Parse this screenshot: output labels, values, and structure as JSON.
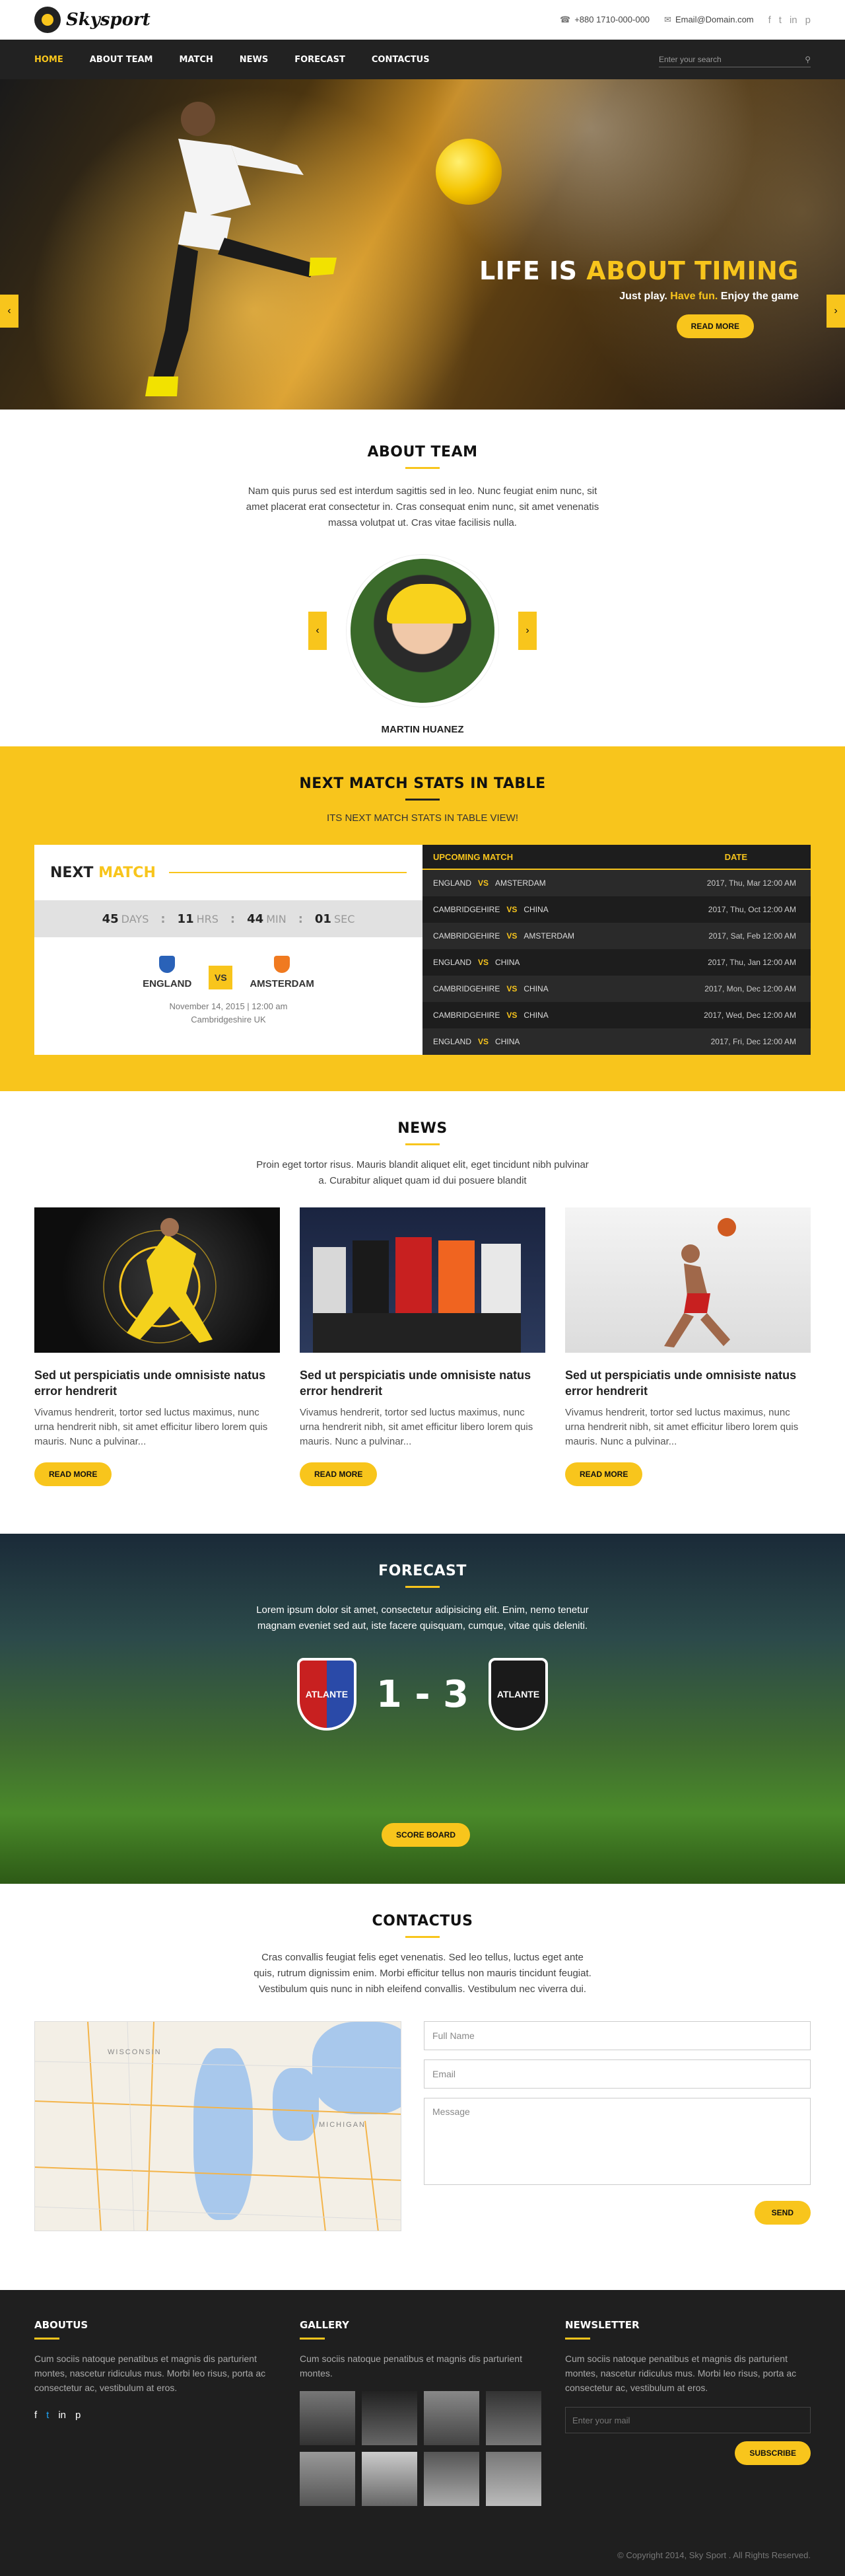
{
  "brand": {
    "logo_text": "Skysport"
  },
  "topbar": {
    "phone": "+880 1710-000-000",
    "email": "Email@Domain.com",
    "social": [
      "f",
      "t",
      "in",
      "p"
    ]
  },
  "nav": {
    "items": [
      "HOME",
      "ABOUT TEAM",
      "MATCH",
      "NEWS",
      "FORECAST",
      "CONTACTUS"
    ],
    "active": "HOME",
    "search_placeholder": "Enter your search"
  },
  "hero": {
    "title_plain": "LIFE IS",
    "title_accent": "ABOUT TIMING",
    "sub_a": "Just play.",
    "sub_b": "Have fun.",
    "sub_c": "Enjoy the game",
    "button": "READ MORE"
  },
  "about": {
    "title": "ABOUT TEAM",
    "text": "Nam quis purus sed est interdum sagittis sed in leo. Nunc feugiat enim nunc, sit amet placerat erat consectetur in. Cras consequat enim nunc, sit amet venenatis massa volutpat ut. Cras vitae facilisis nulla.",
    "coach": "MARTIN HUANEZ"
  },
  "stats": {
    "title": "NEXT MATCH STATS IN TABLE",
    "subtitle": "ITS NEXT MATCH STATS IN TABLE VIEW!",
    "next_plain": "NEXT",
    "next_accent": "MATCH",
    "countdown": {
      "days": "45",
      "days_label": "DAYS",
      "hrs": "11",
      "hrs_label": "HRS",
      "min": "44",
      "min_label": "MIN",
      "sec": "01",
      "sec_label": "SEC"
    },
    "home": "ENGLAND",
    "away": "AMSTERDAM",
    "vs": "VS",
    "date": "November 14, 2015 | 12:00 am",
    "venue": "Cambridgeshire UK",
    "table_head": [
      "UPCOMING MATCH",
      "DATE"
    ],
    "rows": [
      {
        "a": "ENGLAND",
        "b": "AMSTERDAM",
        "d": "2017, Thu, Mar 12:00 AM"
      },
      {
        "a": "CAMBRIDGEHIRE",
        "b": "CHINA",
        "d": "2017, Thu, Oct 12:00 AM"
      },
      {
        "a": "CAMBRIDGEHIRE",
        "b": "AMSTERDAM",
        "d": "2017, Sat, Feb 12:00 AM"
      },
      {
        "a": "ENGLAND",
        "b": "CHINA",
        "d": "2017, Thu, Jan 12:00 AM"
      },
      {
        "a": "CAMBRIDGEHIRE",
        "b": "CHINA",
        "d": "2017, Mon, Dec 12:00 AM"
      },
      {
        "a": "CAMBRIDGEHIRE",
        "b": "CHINA",
        "d": "2017, Wed, Dec 12:00 AM"
      },
      {
        "a": "ENGLAND",
        "b": "CHINA",
        "d": "2017, Fri, Dec 12:00 AM"
      }
    ],
    "row_vs": "VS"
  },
  "news": {
    "title": "NEWS",
    "text": "Proin eget tortor risus. Mauris blandit aliquet elit, eget tincidunt nibh pulvinar a. Curabitur aliquet quam id dui posuere blandit",
    "cards": [
      {
        "title": "Sed ut perspiciatis unde omnisiste natus error hendrerit",
        "text": "Vivamus hendrerit, tortor sed luctus maximus, nunc urna hendrerit nibh, sit amet efficitur libero lorem quis mauris. Nunc a pulvinar...",
        "button": "READ MORE"
      },
      {
        "title": "Sed ut perspiciatis unde omnisiste natus error hendrerit",
        "text": "Vivamus hendrerit, tortor sed luctus maximus, nunc urna hendrerit nibh, sit amet efficitur libero lorem quis mauris. Nunc a pulvinar...",
        "button": "READ MORE"
      },
      {
        "title": "Sed ut perspiciatis unde omnisiste natus error hendrerit",
        "text": "Vivamus hendrerit, tortor sed luctus maximus, nunc urna hendrerit nibh, sit amet efficitur libero lorem quis mauris. Nunc a pulvinar...",
        "button": "READ MORE"
      }
    ]
  },
  "forecast": {
    "title": "FORECAST",
    "text": "Lorem ipsum dolor sit amet, consectetur adipisicing elit. Enim, nemo tenetur magnam eveniet sed aut, iste facere quisquam, cumque, vitae quis deleniti.",
    "team_a": "ATLANTE",
    "team_b": "ATLANTE",
    "score": "1 - 3",
    "button": "SCORE BOARD"
  },
  "contact": {
    "title": "CONTACTUS",
    "text": "Cras convallis feugiat felis eget venenatis. Sed leo tellus, luctus eget ante quis, rutrum dignissim enim. Morbi efficitur tellus non mauris tincidunt feugiat. Vestibulum quis nunc in nibh eleifend convallis. Vestibulum nec viverra dui.",
    "name_ph": "Full Name",
    "email_ph": "Email",
    "msg_ph": "Message",
    "button": "SEND",
    "map_labels": [
      "WISCONSIN",
      "MICHIGAN"
    ]
  },
  "footer": {
    "about_title": "ABOUTUS",
    "about_text": "Cum sociis natoque penatibus et magnis dis parturient montes, nascetur ridiculus mus. Morbi leo risus, porta ac consectetur ac, vestibulum at eros.",
    "gallery_title": "GALLERY",
    "gallery_text": "Cum sociis natoque penatibus et magnis dis parturient montes.",
    "news_title": "NEWSLETTER",
    "news_text": "Cum sociis natoque penatibus et magnis dis parturient montes, nascetur ridiculus mus. Morbi leo risus, porta ac consectetur ac, vestibulum at eros.",
    "mail_ph": "Enter your mail",
    "button": "SUBSCRIBE",
    "copyright": "© Copyright 2014, Sky Sport . All Rights Reserved."
  },
  "colors": {
    "accent": "#f8c51c",
    "dark": "#222222",
    "footer": "#1f1f1f"
  }
}
